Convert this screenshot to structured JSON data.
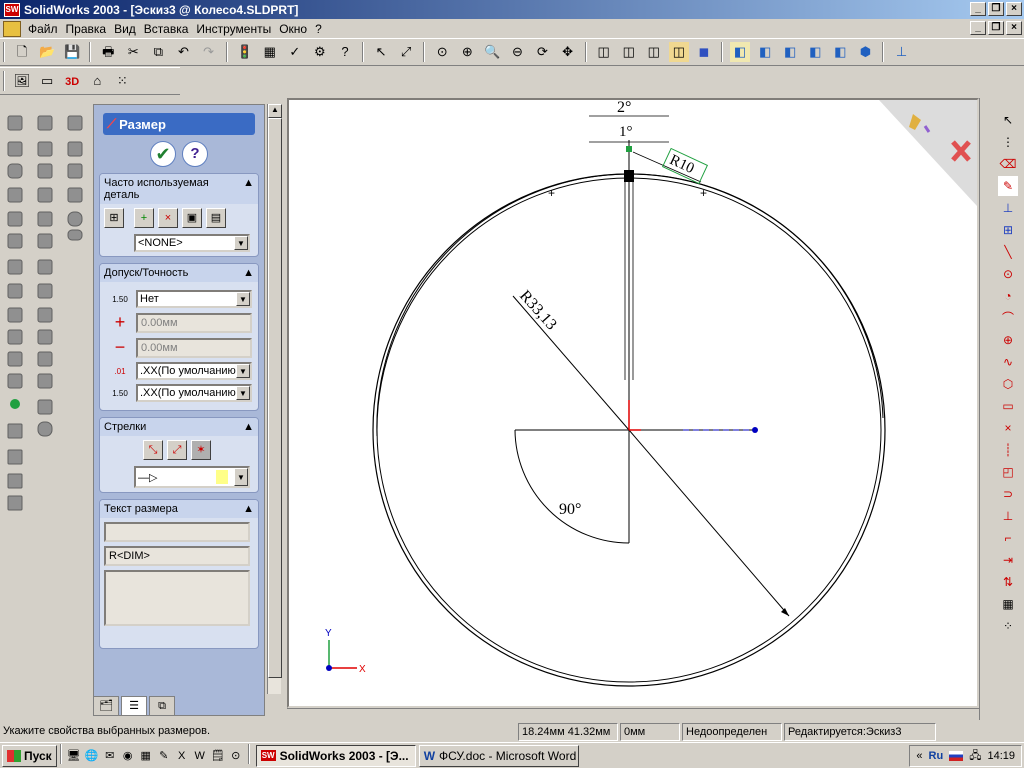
{
  "window": {
    "title": "SolidWorks 2003 - [Эскиз3 @ Колесо4.SLDPRT]",
    "app_icon": "SW"
  },
  "menu": [
    "Файл",
    "Правка",
    "Вид",
    "Вставка",
    "Инструменты",
    "Окно",
    "?"
  ],
  "panel": {
    "title": "Размер",
    "ok_icon": "checkmark-icon",
    "help_label": "?",
    "favorites": {
      "header": "Часто используемая деталь",
      "combo": "<NONE>"
    },
    "tolerance": {
      "header": "Допуск/Точность",
      "type": "Нет",
      "plus": "0.00мм",
      "minus": "0.00мм",
      "primary": ".XX(По умолчанию)",
      "tol_prec": ".XX(По умолчанию)",
      "label_150a": "1.50",
      "label_150b": "1.50"
    },
    "arrows": {
      "header": "Стрелки"
    },
    "text": {
      "header": "Текст размера",
      "line2": "R<DIM>"
    }
  },
  "drawing": {
    "dim_2deg": "2°",
    "dim_1deg": "1°",
    "dim_r10": "R10",
    "dim_r3313": "R33,13",
    "dim_90": "90°",
    "axis_x": "X",
    "axis_y": "Y"
  },
  "status": {
    "message": "Укажите свойства выбранных размеров.",
    "coords": "18.24мм 41.32мм",
    "z": "0мм",
    "state": "Недоопределен",
    "editing": "Редактируется:Эскиз3"
  },
  "taskbar": {
    "start": "Пуск",
    "tasks": [
      "SolidWorks 2003 - [Э...",
      "ФСУ.doc - Microsoft Word"
    ],
    "lang": "Ru",
    "time": "14:19"
  },
  "colors": {
    "title_start": "#0a246a",
    "title_end": "#a6caf0",
    "panel_bg": "#a9b8d8",
    "panel_title": "#3a6bc4"
  }
}
